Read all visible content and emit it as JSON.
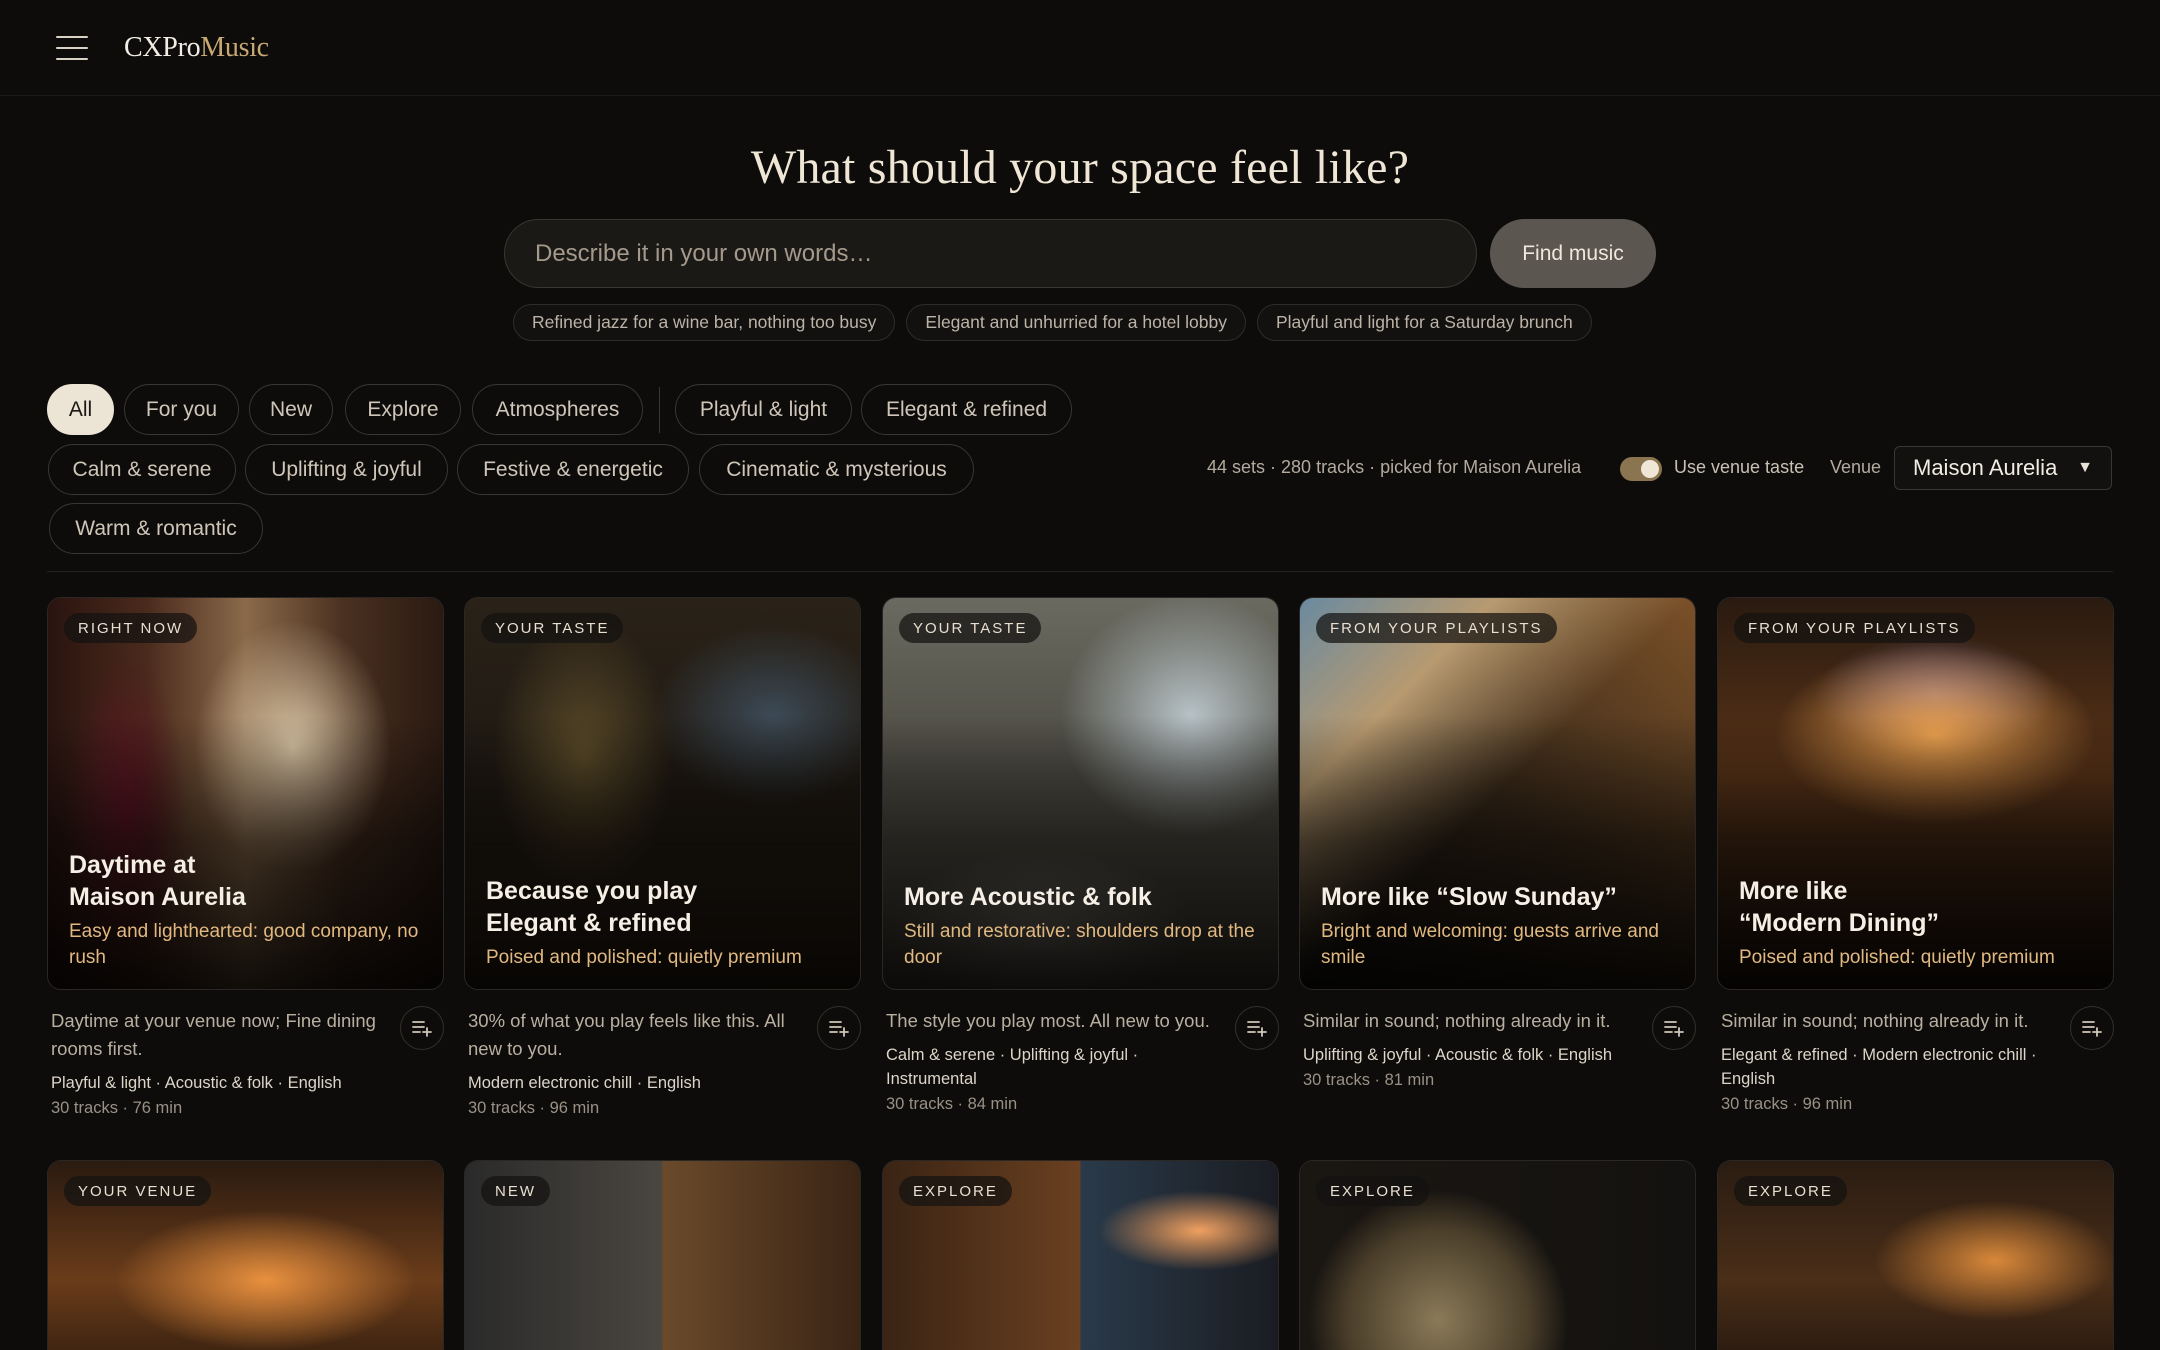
{
  "app": {
    "logo_part1": "CXPro",
    "logo_part2": "Music"
  },
  "hero": {
    "title": "What should your space feel like?",
    "search_placeholder": "Describe it in your own words…",
    "find_button": "Find music",
    "suggestions": [
      "Refined jazz for a wine bar, nothing too busy",
      "Elegant and unhurried for a hotel lobby",
      "Playful and light for a Saturday brunch"
    ]
  },
  "filters": {
    "chips": [
      "All",
      "For you",
      "New",
      "Explore",
      "Atmospheres",
      "Playful & light",
      "Elegant & refined",
      "Calm & serene",
      "Uplifting & joyful",
      "Festive & energetic",
      "Cinematic & mysterious",
      "Warm & romantic"
    ],
    "active": "All"
  },
  "summary": {
    "stats": "44 sets · 280 tracks · picked for Maison Aurelia",
    "toggle_label": "Use venue taste",
    "toggle_on": true,
    "venue_label": "Venue",
    "venue_value": "Maison Aurelia"
  },
  "cards": [
    {
      "tag": "RIGHT NOW",
      "title": "Daytime at\nMaison Aurelia",
      "subtitle": "Easy and lighthearted: good company, no rush",
      "description": "Daytime at your venue now; Fine dining rooms first.",
      "meta": "Playful & light · Acoustic & folk · English",
      "count": "30 tracks · 76 min",
      "icon": "playlist-add-icon"
    },
    {
      "tag": "YOUR TASTE",
      "title": "Because you play\nElegant & refined",
      "subtitle": "Poised and polished: quietly premium",
      "description": "30% of what you play feels like this. All new to you.",
      "meta": "Modern electronic chill · English",
      "count": "30 tracks · 96 min",
      "icon": "playlist-add-icon"
    },
    {
      "tag": "YOUR TASTE",
      "title": "More Acoustic & folk",
      "subtitle": "Still and restorative: shoulders drop at the door",
      "description": "The style you play most. All new to you.",
      "meta": "Calm & serene · Uplifting & joyful · Instrumental",
      "count": "30 tracks · 84 min",
      "icon": "playlist-add-icon"
    },
    {
      "tag": "FROM YOUR PLAYLISTS",
      "title": "More like “Slow Sunday”",
      "subtitle": "Bright and welcoming: guests arrive and smile",
      "description": "Similar in sound; nothing already in it.",
      "meta": "Uplifting & joyful · Acoustic & folk · English",
      "count": "30 tracks · 81 min",
      "icon": "playlist-add-icon"
    },
    {
      "tag": "FROM YOUR PLAYLISTS",
      "title": "More like\n“Modern Dining”",
      "subtitle": "Poised and polished: quietly premium",
      "description": "Similar in sound; nothing already in it.",
      "meta": "Elegant & refined · Modern electronic chill · English",
      "count": "30 tracks · 96 min",
      "icon": "playlist-add-icon"
    }
  ],
  "cards_row2": [
    {
      "tag": "YOUR VENUE"
    },
    {
      "tag": "NEW"
    },
    {
      "tag": "EXPLORE"
    },
    {
      "tag": "EXPLORE"
    },
    {
      "tag": "EXPLORE"
    }
  ],
  "colors": {
    "background": "#0d0c0b",
    "accent_gold": "#c8a973",
    "subtitle_amber": "#e0b880",
    "toggle_on": "#8b7550"
  }
}
